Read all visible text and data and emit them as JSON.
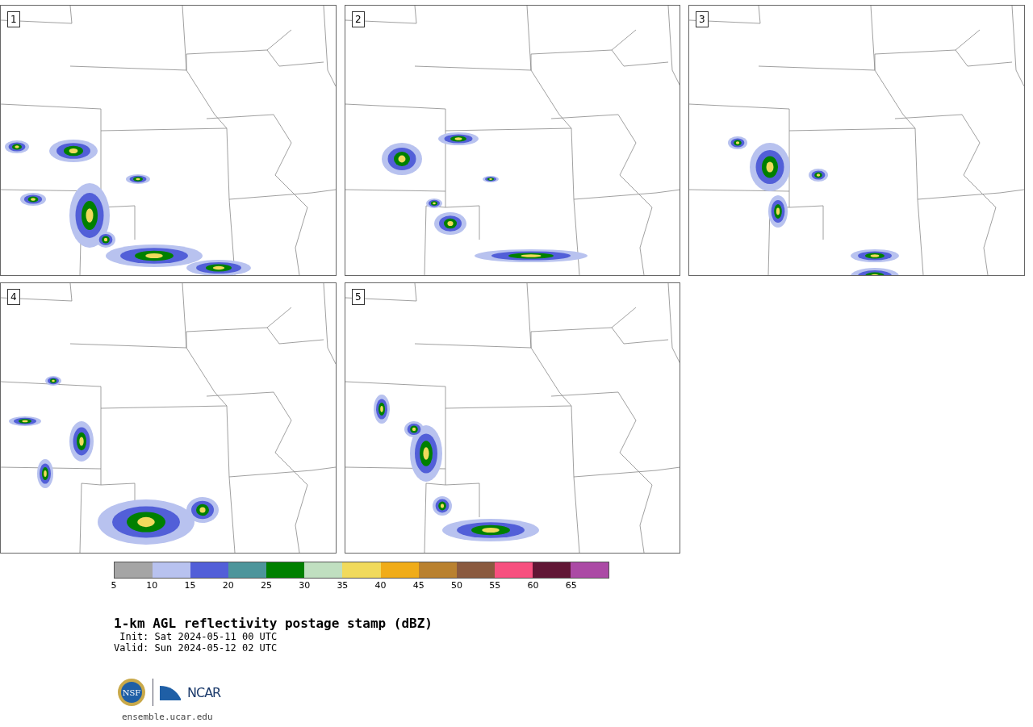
{
  "panels": [
    {
      "label": "1"
    },
    {
      "label": "2"
    },
    {
      "label": "3"
    },
    {
      "label": "4"
    },
    {
      "label": "5"
    }
  ],
  "colorbar": {
    "segments": [
      {
        "color": "#a5a5a5"
      },
      {
        "color": "#b8c2ef"
      },
      {
        "color": "#525fd8"
      },
      {
        "color": "#4d959b"
      },
      {
        "color": "#008000"
      },
      {
        "color": "#c0dfc0"
      },
      {
        "color": "#f1da5c"
      },
      {
        "color": "#f0ac19"
      },
      {
        "color": "#b9812f"
      },
      {
        "color": "#8a5a3f"
      },
      {
        "color": "#f7507f"
      },
      {
        "color": "#611635"
      },
      {
        "color": "#ab4aa5"
      }
    ],
    "ticks": [
      "5",
      "10",
      "15",
      "20",
      "25",
      "30",
      "35",
      "40",
      "45",
      "50",
      "55",
      "60",
      "65"
    ]
  },
  "title": "1-km AGL reflectivity postage stamp (dBZ)",
  "init": " Init: Sat 2024-05-11 00 UTC",
  "valid": "Valid: Sun 2024-05-12 02 UTC",
  "logo_nsf": "NSF",
  "logo_ncar": "NCAR",
  "url": "ensemble.ucar.edu"
}
